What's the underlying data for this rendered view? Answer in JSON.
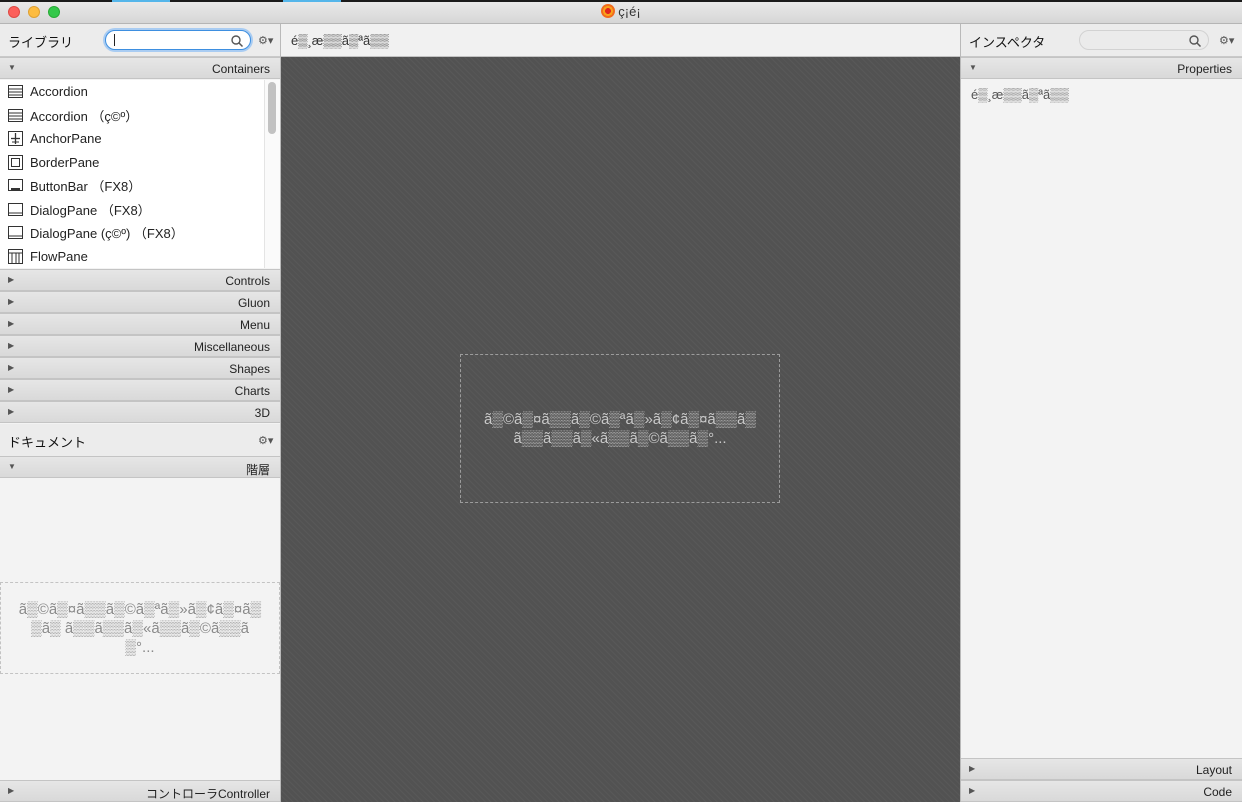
{
  "window": {
    "title": "ç¡é¡"
  },
  "library": {
    "title": "ライブラリ",
    "search": {
      "value": "",
      "placeholder": ""
    },
    "gear": "⚙▾",
    "open_section": "Containers",
    "items": [
      {
        "label": "Accordion",
        "icon": "accordion-icon"
      },
      {
        "label": "Accordion （ç©º）",
        "icon": "accordion-icon"
      },
      {
        "label": "AnchorPane",
        "icon": "anchor-pane-icon"
      },
      {
        "label": "BorderPane",
        "icon": "border-pane-icon"
      },
      {
        "label": "ButtonBar （FX8）",
        "icon": "button-bar-icon"
      },
      {
        "label": "DialogPane （FX8）",
        "icon": "dialog-pane-icon"
      },
      {
        "label": "DialogPane (ç©º) （FX8）",
        "icon": "dialog-pane-icon"
      },
      {
        "label": "FlowPane",
        "icon": "flow-pane-icon"
      }
    ],
    "sections": [
      "Controls",
      "Gluon",
      "Menu",
      "Miscellaneous",
      "Shapes",
      "Charts",
      "3D"
    ]
  },
  "document": {
    "title": "ドキュメント",
    "gear": "⚙▾",
    "hierarchy_section": "階層",
    "empty_text": "ã▒©ã▒¤ã▒▒ã▒©ã▒ªã▒»ã▒¢ã▒¤ã▒▒ã▒ ã▒▒ã▒▒ã▒«ã▒▒ã▒©ã▒▒ã▒°...",
    "controller_section": "コントローラController"
  },
  "canvas": {
    "path": "é▒¸æ▒▒ã▒ªã▒▒",
    "placeholder": "ã▒©ã▒¤ã▒▒ã▒©ã▒ªã▒»ã▒¢ã▒¤ã▒▒ã▒ ã▒▒ã▒▒ã▒«ã▒▒ã▒©ã▒▒ã▒°..."
  },
  "inspector": {
    "title": "インスペクタ",
    "search": {
      "value": "",
      "placeholder": ""
    },
    "gear": "⚙▾",
    "properties_section": "Properties",
    "empty_text": "é▒¸æ▒▒ã▒ªã▒▒",
    "layout_section": "Layout",
    "code_section": "Code"
  },
  "colors": {
    "focus": "#3e8fe0",
    "canvas": "#525252"
  }
}
